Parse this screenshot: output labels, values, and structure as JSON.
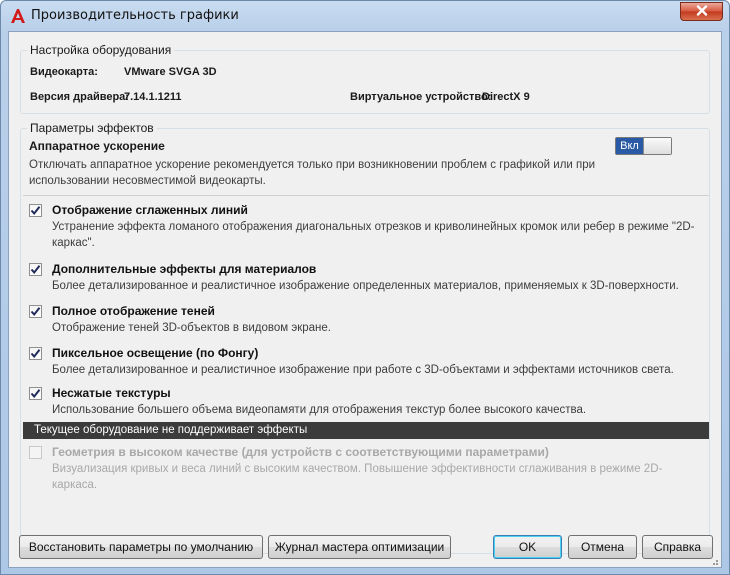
{
  "window": {
    "title": "Производительность графики"
  },
  "hardware": {
    "legend": "Настройка оборудования",
    "gpu_label": "Видеокарта:",
    "gpu_value": "VMware SVGA 3D",
    "driver_label": "Версия драйвера:",
    "driver_value": "7.14.1.1211",
    "virtual_label": "Виртуальное устройство:",
    "virtual_value": "DirectX 9"
  },
  "effects": {
    "legend": "Параметры эффектов",
    "hw_accel_title": "Аппаратное ускорение",
    "hw_accel_desc": "Отключать аппаратное ускорение рекомендуется только при возникновении проблем с графикой или при использовании несовместимой видеокарты.",
    "toggle_label": "Вкл",
    "toggle_on": true,
    "items": [
      {
        "title": "Отображение сглаженных линий",
        "desc": "Устранение эффекта ломаного отображения диагональных отрезков и криволинейных кромок или ребер в режиме \"2D-каркас\".",
        "checked": true
      },
      {
        "title": "Дополнительные эффекты для материалов",
        "desc": "Более детализированное и реалистичное изображение определенных материалов, применяемых к 3D-поверхности.",
        "checked": true
      },
      {
        "title": "Полное отображение теней",
        "desc": "Отображение теней 3D-объектов в видовом экране.",
        "checked": true
      },
      {
        "title": "Пиксельное освещение (по Фонгу)",
        "desc": "Более детализированное и реалистичное изображение при работе с 3D-объектами и эффектами источников света.",
        "checked": true
      },
      {
        "title": "Несжатые текстуры",
        "desc": "Использование большего объема видеопамяти для отображения текстур более высокого качества.",
        "checked": true
      }
    ],
    "unsupported_banner": "Текущее оборудование не поддерживает эффекты",
    "disabled_item": {
      "title": "Геометрия в высоком качестве (для устройств с соответствующими параметрами)",
      "desc": "Визуализация кривых и веса линий с высоким качеством. Повышение эффективности сглаживания в режиме 2D-каркаса.",
      "checked": false
    }
  },
  "buttons": {
    "restore": "Восстановить параметры по умолчанию",
    "log": "Журнал мастера оптимизации",
    "ok": "OK",
    "cancel": "Отмена",
    "help": "Справка"
  }
}
